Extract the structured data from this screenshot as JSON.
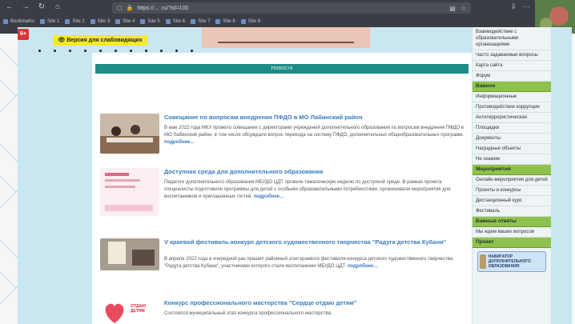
{
  "browser": {
    "url": "https://... .ru/?id=100",
    "bookmarks": [
      "Bookmarks",
      "Site 1",
      "Site 2",
      "Site 3",
      "Site 4",
      "Site 5",
      "Site 6",
      "Site 7",
      "Site 8",
      "Site 9"
    ]
  },
  "page": {
    "age_badge": "6+",
    "vision_button": "Версия для слабовидящих",
    "section_title": "Новости"
  },
  "news": [
    {
      "title": "Совещание по вопросам внедрения ПФДО в МО Лабинский район",
      "text": "В мае 2022 года МКУ провело совещание с директорами учреждений дополнительного образования по вопросам внедрения ПФДО в МО Лабинский район, в том числе обсуждали вопрос перехода на систему ПФДО, дополнительных общеобразовательных программ.",
      "more": "подробнее..."
    },
    {
      "title": "Доступная среда для дополнительного образования",
      "text": "Педагоги дополнительного образования МБУДО ЦДТ провели тематическую неделю по доступной среде. В рамках проекта специалисты подготовили программы для детей с особыми образовательными потребностями, организовали мероприятия для воспитанников и приглашенных гостей.",
      "more": "подробнее..."
    },
    {
      "title": "V краевой фестиваль-конкурс детского художественного творчества \"Радуга детства Кубани\"",
      "text": "В апреле 2022 года в очередной раз прошел районный этап краевого фестиваля-конкурса детского художественного творчества \"Радуга детства Кубани\", участниками которого стали воспитанники МБУДО ЦДТ.",
      "more": "подробнее..."
    },
    {
      "title": "Конкурс профессионального мастерства \"Сердце отдаю детям\"",
      "text": "Состоялся муниципальный этап конкурса профессионального мастерства.",
      "more": ""
    }
  ],
  "thumb_caption_4": "ОТДАЮ ДЕТЯМ",
  "sidebar": {
    "items_top": [
      "Взаимодействие с образовательными организациями",
      "Часто задаваемые вопросы",
      "Карта сайта",
      "Форум"
    ],
    "head_1": "Важное",
    "items_1": [
      "Информационные",
      "Противодействие коррупции",
      "Антитеррористическая",
      "Площадки",
      "Документы",
      "Наградные объекты",
      "Не скажем"
    ],
    "head_2": "Мероприятия",
    "items_2": [
      "Онлайн-мероприятия для детей",
      "Проекты и конкурсы",
      "Дистанционный курс",
      "Фестиваль"
    ],
    "head_3": "Важные ответы",
    "items_3": [
      "Мы ждем ваших вопросов"
    ],
    "head_4": "Проект",
    "ad_text": "НАВИГАТОР ДОПОЛНИТЕЛЬНОГО ОБРАЗОВАНИЯ"
  }
}
